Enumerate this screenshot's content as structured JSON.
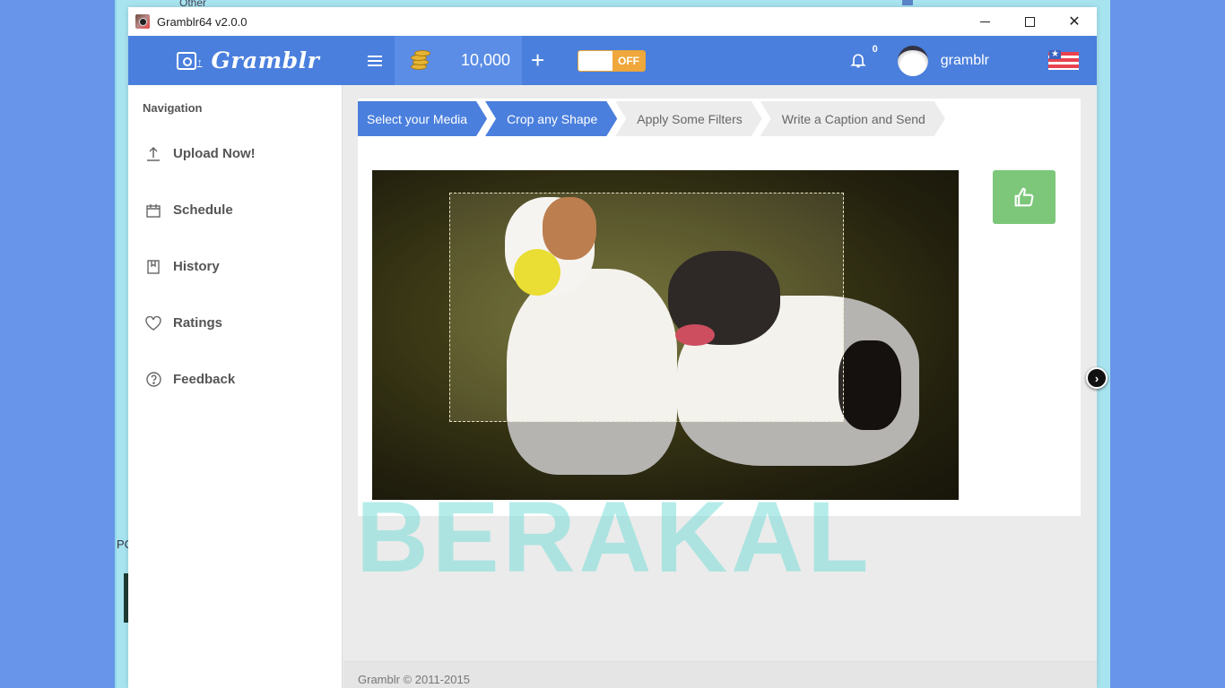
{
  "background_window": {
    "tab_label": "Other",
    "partial_label": "PC"
  },
  "window": {
    "title": "Gramblr64 v2.0.0",
    "controls": [
      "minimize",
      "maximize",
      "close"
    ]
  },
  "header": {
    "brand": "Gramblr",
    "logo_icon": "instagram-upload-icon",
    "menu_icon": "hamburger-icon",
    "coins_icon": "coins-icon",
    "coins": "10,000",
    "add_coins_label": "+",
    "toggle_state": "OFF",
    "notifications_count": "0",
    "username": "gramblr",
    "language_flag": "us-flag"
  },
  "sidebar": {
    "title": "Navigation",
    "items": [
      {
        "label": "Upload Now!",
        "icon": "upload-icon"
      },
      {
        "label": "Schedule",
        "icon": "calendar-icon"
      },
      {
        "label": "History",
        "icon": "bookmark-icon"
      },
      {
        "label": "Ratings",
        "icon": "heart-icon"
      },
      {
        "label": "Feedback",
        "icon": "help-circle-icon"
      }
    ]
  },
  "wizard": {
    "steps": [
      {
        "label": "Select your Media",
        "active": true
      },
      {
        "label": "Crop any Shape",
        "active": true
      },
      {
        "label": "Apply Some Filters",
        "active": false
      },
      {
        "label": "Write a Caption and Send",
        "active": false
      }
    ]
  },
  "editor": {
    "image_description": "Two Jack Russell terriers running on grass, one holding a yellow tennis ball",
    "confirm_icon": "thumbs-up-icon",
    "next_icon": "chevron-right-icon"
  },
  "watermark": "BERAKAL",
  "footer": {
    "copyright": "Gramblr © 2011-2015"
  },
  "colors": {
    "primary": "#4a7fdd",
    "toggle_off": "#f0a73c",
    "confirm": "#7cc77a",
    "desktop": "#6895ea"
  }
}
